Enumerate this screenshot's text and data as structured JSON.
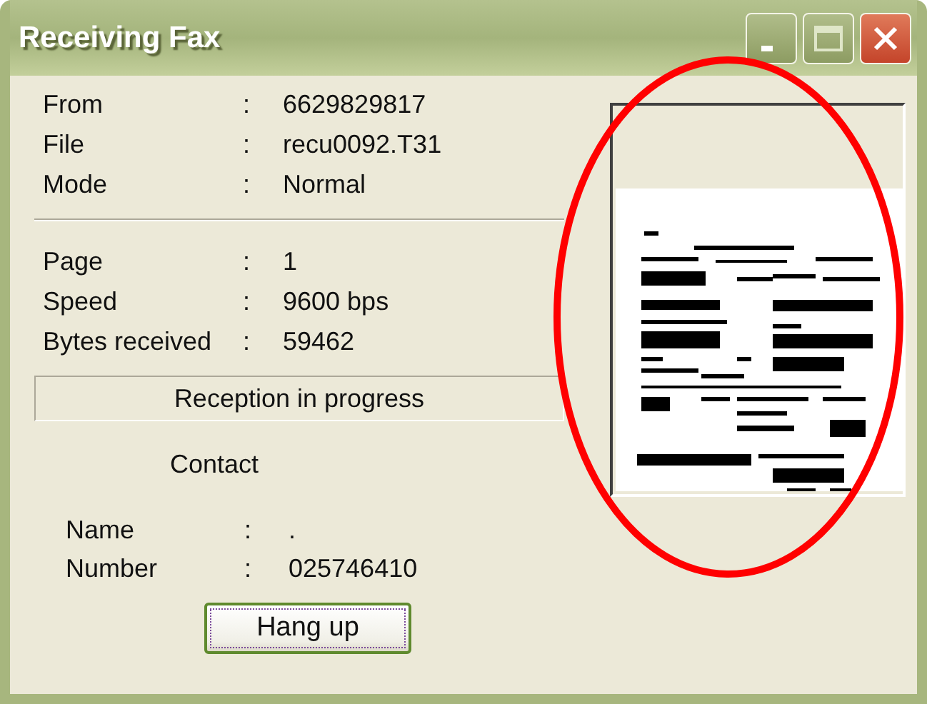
{
  "window": {
    "title": "Receiving Fax"
  },
  "file_info": [
    {
      "label": "From",
      "value": "6629829817"
    },
    {
      "label": "File",
      "value": "recu0092.T31"
    },
    {
      "label": "Mode",
      "value": "Normal"
    }
  ],
  "progress_info": [
    {
      "label": "Page",
      "value": "1"
    },
    {
      "label": "Speed",
      "value": "9600 bps"
    },
    {
      "label": "Bytes received",
      "value": "59462"
    }
  ],
  "status": "Reception in progress",
  "contact": {
    "heading": "Contact",
    "fields": [
      {
        "label": "Name",
        "value": "."
      },
      {
        "label": "Number",
        "value": "025746410"
      }
    ]
  },
  "separator": ":",
  "hang_up_button": "Hang up"
}
